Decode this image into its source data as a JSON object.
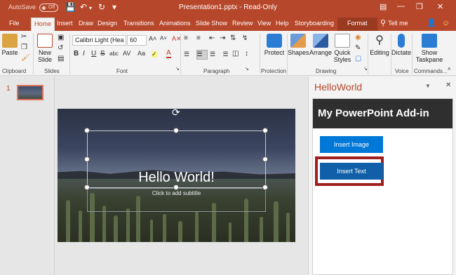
{
  "titlebar": {
    "autosave_label": "AutoSave",
    "autosave_state": "Off",
    "document_title": "Presentation1.pptx  -  Read-Only",
    "icons": [
      "save-icon",
      "undo-icon",
      "redo-icon",
      "customize-qat-icon",
      "ribbon-display-icon",
      "minimize-icon",
      "restore-icon",
      "close-icon"
    ]
  },
  "tabs": {
    "file": "File",
    "home": "Home",
    "insert": "Insert",
    "draw": "Draw",
    "design": "Design",
    "transitions": "Transitions",
    "animations": "Animations",
    "slideshow": "Slide Show",
    "review": "Review",
    "view": "View",
    "help": "Help",
    "storyboarding": "Storyboarding",
    "format": "Format",
    "tellme": "Tell me"
  },
  "ribbon": {
    "paste": "Paste",
    "new_slide_line1": "New",
    "new_slide_line2": "Slide",
    "font_name": "Calibri Light (Hea",
    "font_size": "60",
    "protect": "Protect",
    "shapes": "Shapes",
    "arrange": "Arrange",
    "quick_styles_line1": "Quick",
    "quick_styles_line2": "Styles",
    "editing": "Editing",
    "dictate": "Dictate",
    "show_taskpane_line1": "Show",
    "show_taskpane_line2": "Taskpane",
    "groups": {
      "clipboard": "Clipboard",
      "slides": "Slides",
      "font": "Font",
      "paragraph": "Paragraph",
      "protection": "Protection",
      "drawing": "Drawing",
      "voice": "Voice",
      "commands": "Commands..."
    },
    "font_buttons": [
      "B",
      "I",
      "U",
      "S",
      "abc",
      "AV",
      "Aa",
      "A"
    ]
  },
  "thumbnails": {
    "slide_number": "1"
  },
  "slide": {
    "title": "Hello World!",
    "subtitle": "Click to add subtitle"
  },
  "taskpane": {
    "title": "HelloWorld",
    "header": "My PowerPoint Add-in",
    "insert_image": "Insert Image",
    "insert_text": "Insert Text"
  },
  "colors": {
    "accent": "#b7472a",
    "button": "#0078d7",
    "highlight": "#a01e1e"
  }
}
